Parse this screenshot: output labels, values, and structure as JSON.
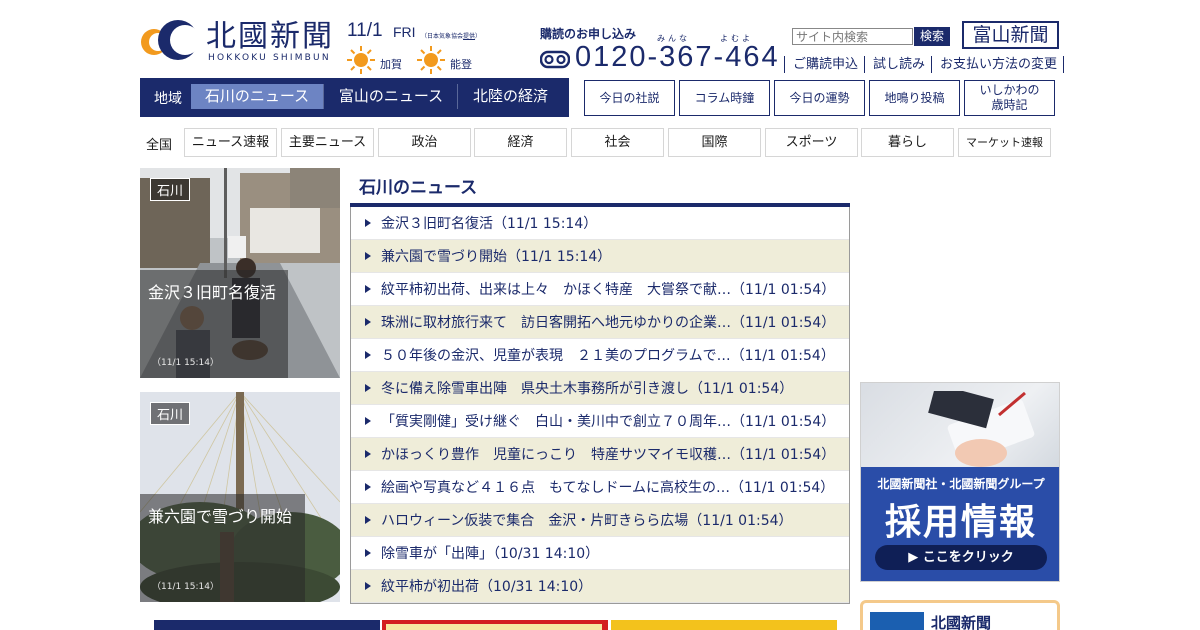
{
  "header": {
    "logo_text": "北國新聞",
    "logo_sub": "HOKKOKU SHIMBUN",
    "date": "11/1",
    "day_of_week": "FRI",
    "date_credit_prefix": "（日本気象協会",
    "date_credit_link": "提供",
    "date_credit_suffix": "）",
    "weather": [
      {
        "place": "加賀",
        "icon": "sun-icon"
      },
      {
        "place": "能登",
        "icon": "sun-icon"
      }
    ],
    "subscribe_title": "購読のお申し込み",
    "subscribe_ruby_1": "みんな",
    "subscribe_ruby_2": "よむよ",
    "phone_number": "0120-367-464",
    "search_placeholder": "サイト内検索",
    "search_button": "検索",
    "toyama_logo": "富山新聞",
    "util_links": [
      "ご購読申込",
      "試し読み",
      "お支払い方法の変更"
    ]
  },
  "region_nav": {
    "label": "地域",
    "tabs": [
      "石川のニュース",
      "富山のニュース",
      "北陸の経済"
    ],
    "active_tab": "石川のニュース"
  },
  "column_buttons": [
    "今日の社説",
    "コラム時鐘",
    "今日の運勢",
    "地鳴り投稿",
    "いしかわの\n歳時記"
  ],
  "categories": {
    "label": "全国",
    "items": [
      "ニュース速報",
      "主要ニュース",
      "政治",
      "経済",
      "社会",
      "国際",
      "スポーツ",
      "暮らし",
      "マーケット速報"
    ]
  },
  "photo_cards": [
    {
      "badge": "石川",
      "title": "金沢３旧町名復活",
      "time": "（11/1 15:14）"
    },
    {
      "badge": "石川",
      "title": "兼六園で雪づり開始",
      "time": "（11/1 15:14）"
    }
  ],
  "news": {
    "title": "石川のニュース",
    "items": [
      "金沢３旧町名復活（11/1 15:14）",
      "兼六園で雪づり開始（11/1 15:14）",
      "紋平柿初出荷、出来は上々　かほく特産　大嘗祭で献…（11/1 01:54）",
      "珠洲に取材旅行来て　訪日客開拓へ地元ゆかりの企業…（11/1 01:54）",
      "５０年後の金沢、児童が表現　２１美のプログラムで…（11/1 01:54）",
      "冬に備え除雪車出陣　県央土木事務所が引き渡し（11/1 01:54）",
      "「質実剛健」受け継ぐ　白山・美川中で創立７０周年…（11/1 01:54）",
      "かほっくり豊作　児童にっこり　特産サツマイモ収穫…（11/1 01:54）",
      "絵画や写真など４１６点　もてなしドームに高校生の…（11/1 01:54）",
      "ハロウィーン仮装で集合　金沢・片町きらら広場（11/1 01:54）",
      "除雪車が「出陣」（10/31 14:10）",
      "紋平柿が初出荷（10/31 14:10）"
    ]
  },
  "ad": {
    "line1": "北國新聞社・北國新聞グループ",
    "line2": "採用情報",
    "cta": "▶ ここをクリック"
  },
  "promo": {
    "label": "北國新聞"
  },
  "colors": {
    "brand_navy": "#1b2a6b",
    "active_tab": "#6d84c3",
    "stripe": "#efedd9",
    "ad_blue": "#2a4da8",
    "logo_orange": "#f29a1e"
  }
}
